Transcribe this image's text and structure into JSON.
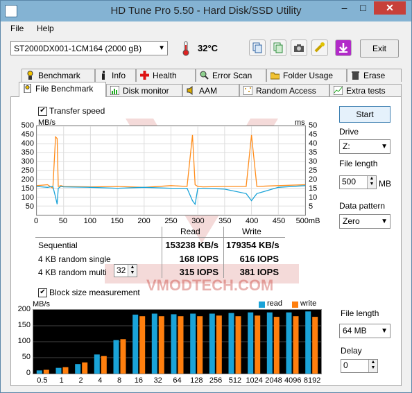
{
  "window": {
    "title": "HD Tune Pro 5.50 - Hard Disk/SSD Utility",
    "min": "–",
    "max": "□",
    "close": "✕"
  },
  "menu": {
    "file": "File",
    "help": "Help"
  },
  "toolbar": {
    "drive": "ST2000DX001-1CM164 (2000 gB)",
    "temperature": "32",
    "temp_unit": "°C",
    "exit": "Exit"
  },
  "tabs_row1": [
    {
      "label": "Benchmark",
      "icon": "benchmark-icon"
    },
    {
      "label": "Info",
      "icon": "info-icon"
    },
    {
      "label": "Health",
      "icon": "health-icon"
    },
    {
      "label": "Error Scan",
      "icon": "error-scan-icon"
    },
    {
      "label": "Folder Usage",
      "icon": "folder-icon"
    },
    {
      "label": "Erase",
      "icon": "erase-icon"
    }
  ],
  "tabs_row2": [
    {
      "label": "File Benchmark",
      "icon": "file-benchmark-icon",
      "active": true
    },
    {
      "label": "Disk monitor",
      "icon": "disk-monitor-icon"
    },
    {
      "label": "AAM",
      "icon": "speaker-icon"
    },
    {
      "label": "Random Access",
      "icon": "random-access-icon"
    },
    {
      "label": "Extra tests",
      "icon": "extra-tests-icon"
    }
  ],
  "transfer": {
    "checkbox_label": "Transfer speed",
    "checked": true,
    "unit_left": "MB/s",
    "unit_right": "ms"
  },
  "results": {
    "col_read": "Read",
    "col_write": "Write",
    "rows": [
      {
        "label": "Sequential",
        "read": "153238 KB/s",
        "write": "179354 KB/s"
      },
      {
        "label": "4 KB random single",
        "read": "168 IOPS",
        "write": "616 IOPS"
      },
      {
        "label": "4 KB random multi",
        "read": "315 IOPS",
        "write": "381 IOPS"
      }
    ],
    "queue_depth": "32"
  },
  "block": {
    "checkbox_label": "Block size measurement",
    "checked": true,
    "unit": "MB/s",
    "legend_read": "read",
    "legend_write": "write"
  },
  "side": {
    "start": "Start",
    "drive_label": "Drive",
    "drive_value": "Z:",
    "file_length_label": "File length",
    "file_length_value": "500",
    "file_length_unit": "MB",
    "pattern_label": "Data pattern",
    "pattern_value": "Zero",
    "file_length2_label": "File length",
    "file_length2_value": "64 MB",
    "delay_label": "Delay",
    "delay_value": "0"
  },
  "watermark_text": "VMODTECH.COM",
  "colors": {
    "read": "#1aa3d8",
    "write": "#ff7f0e",
    "line_read": "#1aa3d8",
    "line_write": "#ff8c1a"
  },
  "chart_data": [
    {
      "type": "line",
      "x": [
        0,
        20,
        30,
        35,
        38,
        40,
        45,
        50,
        100,
        150,
        200,
        250,
        280,
        290,
        295,
        300,
        310,
        350,
        390,
        400,
        410,
        450,
        500
      ],
      "xlim": [
        0,
        500
      ],
      "ylim": [
        0,
        500
      ],
      "y2lim": [
        0,
        50
      ],
      "xticks": [
        "0",
        "50",
        "100",
        "150",
        "200",
        "250",
        "300",
        "350",
        "400",
        "450",
        "500mB"
      ],
      "yticks": [
        "500",
        "450",
        "400",
        "350",
        "300",
        "250",
        "200",
        "150",
        "100",
        "50"
      ],
      "y2ticks": [
        "50",
        "45",
        "40",
        "35",
        "30",
        "25",
        "20",
        "15",
        "10",
        "5"
      ],
      "series": [
        {
          "values": [
            165,
            170,
            150,
            440,
            430,
            160,
            165,
            160,
            158,
            160,
            155,
            165,
            160,
            450,
            170,
            160,
            158,
            160,
            160,
            450,
            160,
            165,
            170
          ]
        },
        {
          "values": [
            160,
            155,
            160,
            100,
            60,
            150,
            160,
            158,
            155,
            150,
            155,
            150,
            150,
            80,
            60,
            150,
            150,
            145,
            120,
            80,
            120,
            155,
            165
          ]
        }
      ]
    },
    {
      "type": "bar",
      "categories": [
        "0.5",
        "1",
        "2",
        "4",
        "8",
        "16",
        "32",
        "64",
        "128",
        "256",
        "512",
        "1024",
        "2048",
        "4096",
        "8192"
      ],
      "ylim": [
        0,
        200
      ],
      "yticks": [
        "200",
        "150",
        "100",
        "50",
        "0"
      ],
      "series": [
        {
          "name": "read",
          "values": [
            10,
            18,
            30,
            60,
            105,
            185,
            188,
            186,
            188,
            188,
            190,
            192,
            192,
            192,
            195
          ]
        },
        {
          "name": "write",
          "values": [
            12,
            20,
            35,
            55,
            108,
            180,
            180,
            180,
            180,
            182,
            180,
            182,
            178,
            180,
            178
          ]
        }
      ]
    }
  ]
}
